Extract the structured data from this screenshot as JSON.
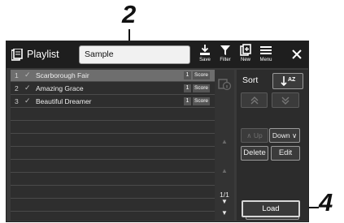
{
  "callouts": {
    "name_step": "2",
    "load_step": "4"
  },
  "header": {
    "title": "Playlist",
    "playlist_name": "Sample",
    "toolbar": [
      {
        "label": "Save",
        "icon": "save-icon"
      },
      {
        "label": "Filter",
        "icon": "filter-icon"
      },
      {
        "label": "New",
        "icon": "new-icon"
      },
      {
        "label": "Menu",
        "icon": "menu-icon"
      }
    ],
    "close_icon": "close-icon"
  },
  "records": [
    {
      "num": "1",
      "title": "Scarborough Fair",
      "count": "1",
      "tag": "Score",
      "selected": true
    },
    {
      "num": "2",
      "title": "Amazing Grace",
      "count": "1",
      "tag": "Score",
      "selected": false
    },
    {
      "num": "3",
      "title": "Beautiful Dreamer",
      "count": "1",
      "tag": "Score",
      "selected": false
    }
  ],
  "pagination": {
    "page": "1/1"
  },
  "side": {
    "sort_label": "Sort",
    "sort_az_label": "AZ",
    "up_label": "Up",
    "down_label": "Down",
    "delete_label": "Delete",
    "edit_label": "Edit",
    "add_record_label": "Add Record",
    "load_label": "Load"
  },
  "colors": {
    "titlebar": "#1e1e1e",
    "panel": "#3a3a3a",
    "selected_row": "#6e6e6e"
  }
}
